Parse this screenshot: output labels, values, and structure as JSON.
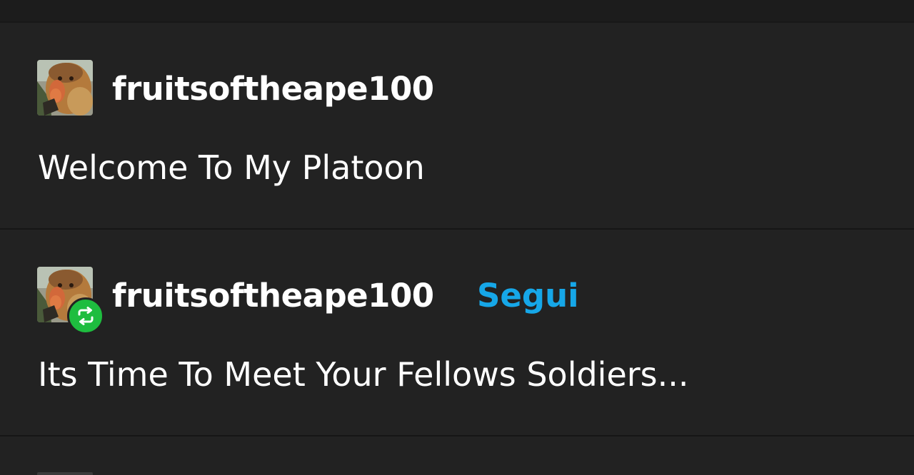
{
  "feed": {
    "posts": [
      {
        "username": "fruitsoftheape100",
        "avatar_icon": "proboscis-monkey-avatar",
        "text": "Welcome To My Platoon"
      },
      {
        "username": "fruitsoftheape100",
        "avatar_icon": "proboscis-monkey-avatar",
        "badge_icon": "reblog-icon",
        "follow_label": "Segui",
        "text": "Its Time To Meet Your Fellows Soldiers..."
      }
    ]
  },
  "colors": {
    "background": "#222222",
    "text": "#ffffff",
    "follow": "#16a7e8",
    "reblog_badge": "#1ebd3f"
  }
}
